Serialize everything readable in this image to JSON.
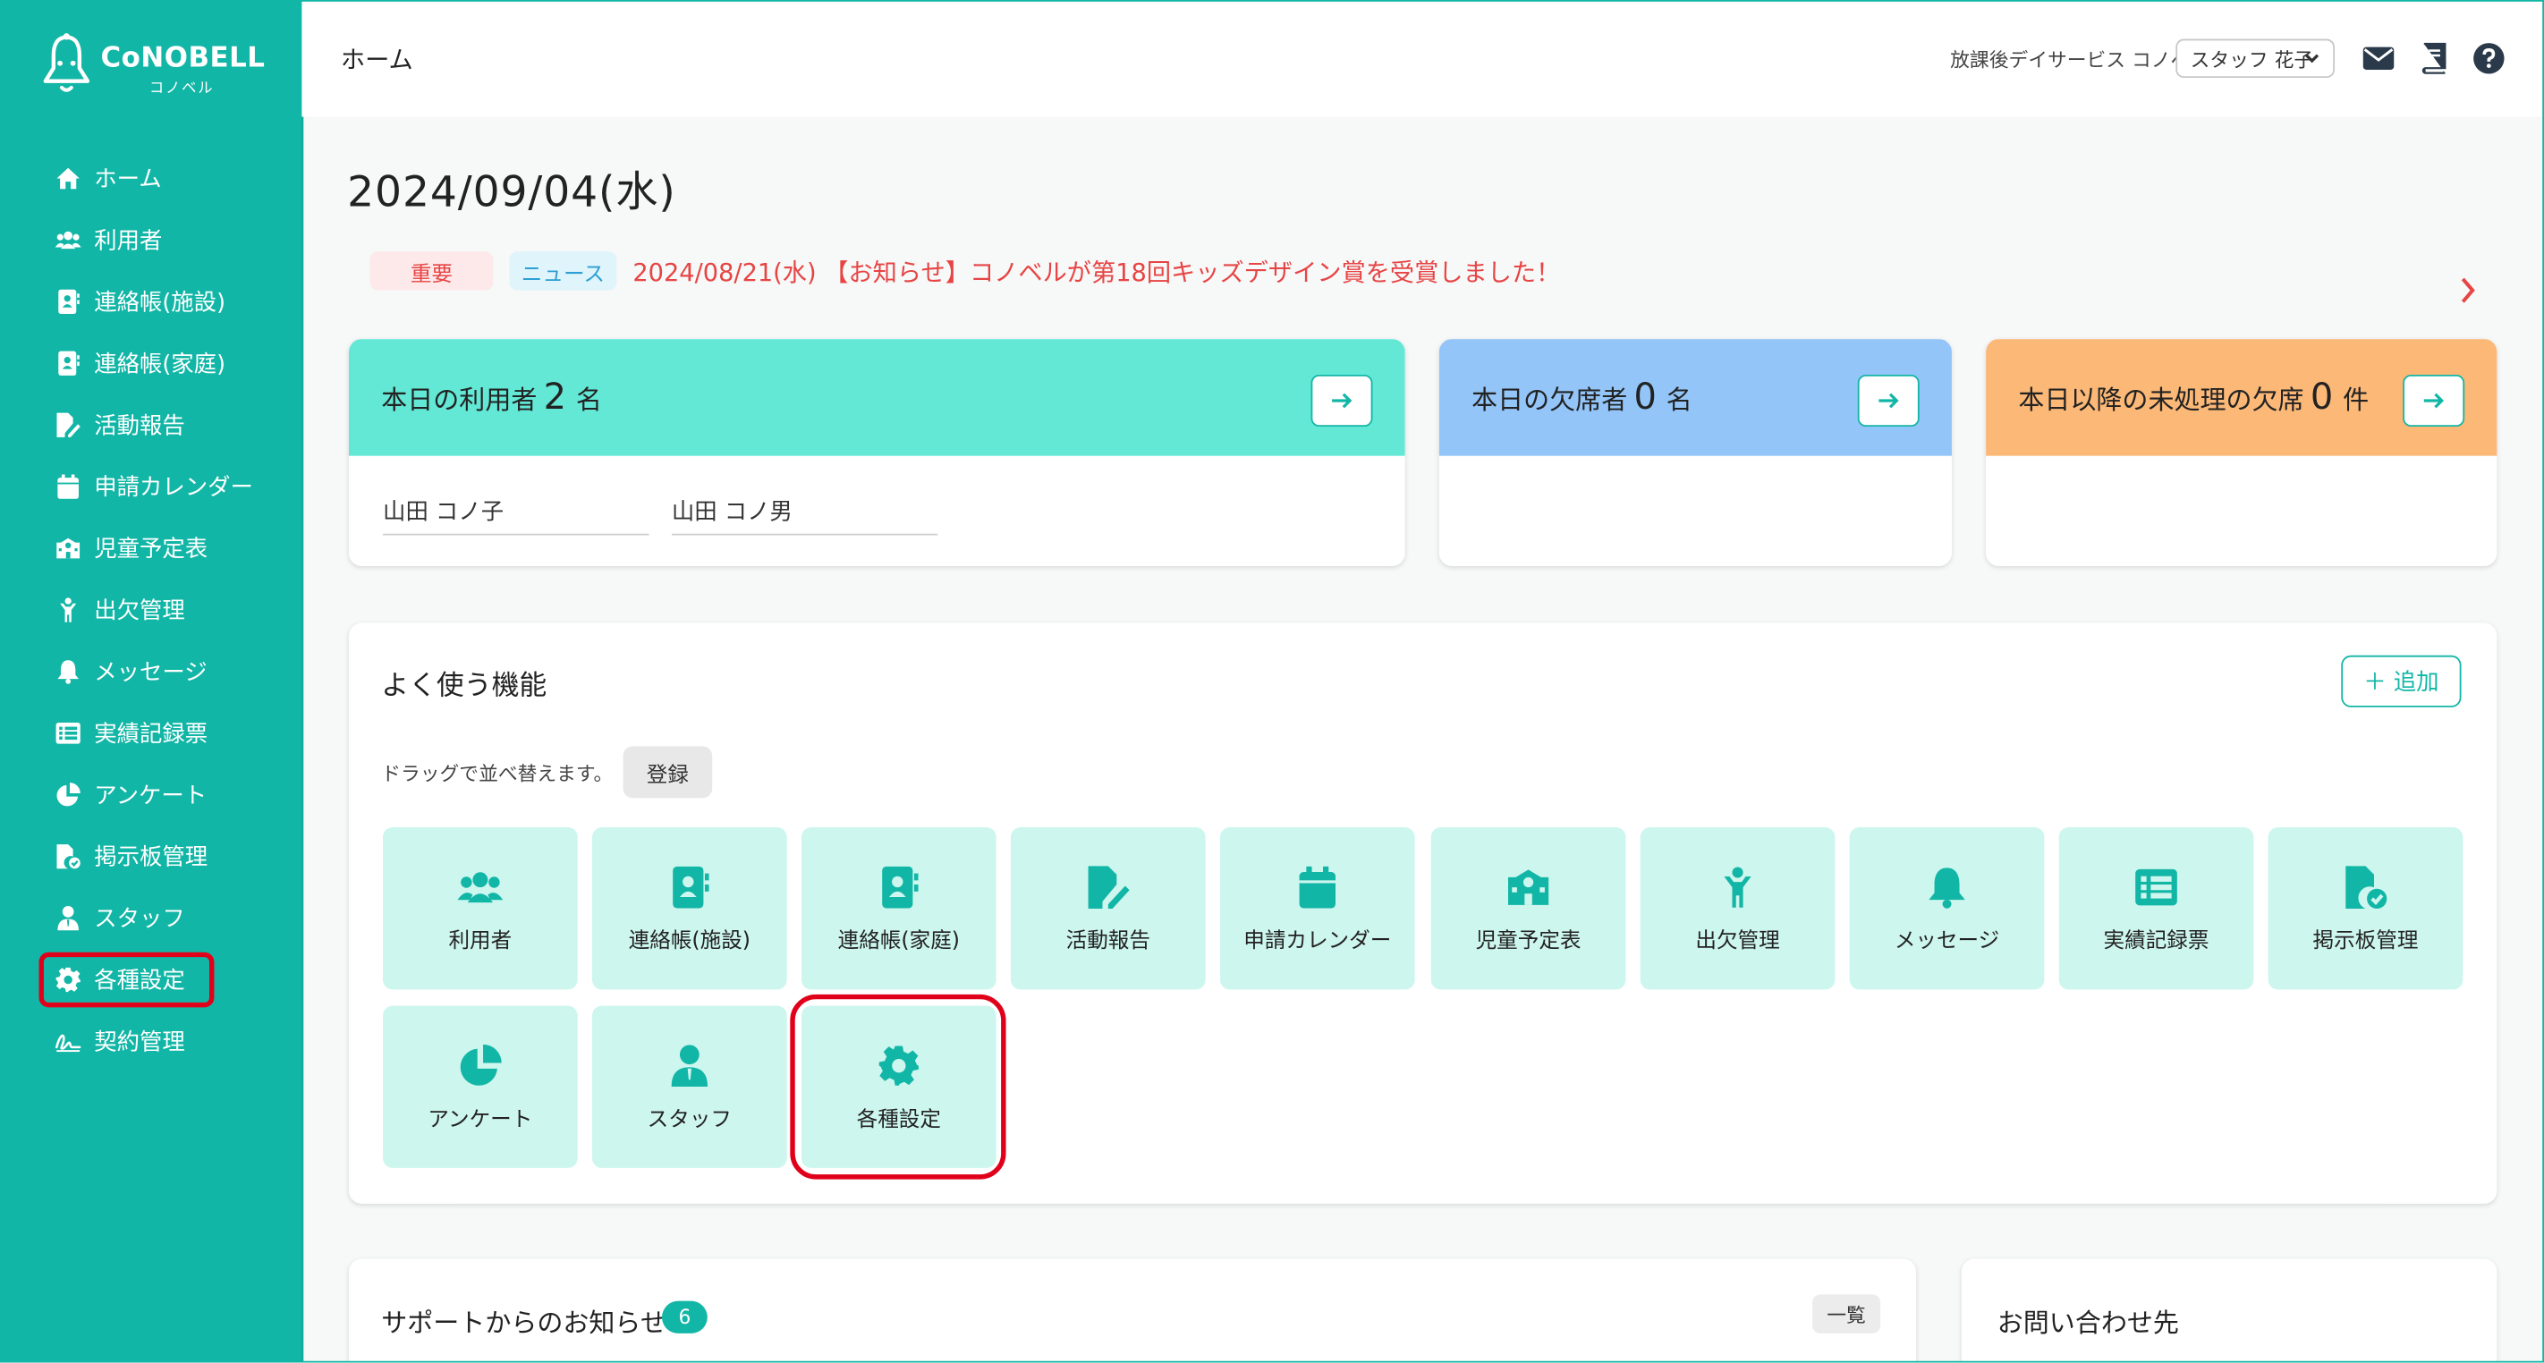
{
  "app": {
    "logo_text": "CoNOBELL",
    "logo_sub": "コノベル"
  },
  "sidebar": {
    "items": [
      {
        "label": "ホーム",
        "icon": "home-icon"
      },
      {
        "label": "利用者",
        "icon": "users-icon"
      },
      {
        "label": "連絡帳(施設)",
        "icon": "contact-book-icon"
      },
      {
        "label": "連絡帳(家庭)",
        "icon": "contact-book-icon"
      },
      {
        "label": "活動報告",
        "icon": "file-edit-icon"
      },
      {
        "label": "申請カレンダー",
        "icon": "calendar-icon"
      },
      {
        "label": "児童予定表",
        "icon": "school-icon"
      },
      {
        "label": "出欠管理",
        "icon": "child-icon"
      },
      {
        "label": "メッセージ",
        "icon": "bell-icon"
      },
      {
        "label": "実績記録票",
        "icon": "table-list-icon"
      },
      {
        "label": "アンケート",
        "icon": "pie-chart-icon"
      },
      {
        "label": "掲示板管理",
        "icon": "file-check-icon"
      },
      {
        "label": "スタッフ",
        "icon": "staff-icon"
      },
      {
        "label": "各種設定",
        "icon": "gear-icon",
        "highlighted": true
      },
      {
        "label": "契約管理",
        "icon": "signature-icon"
      }
    ]
  },
  "header": {
    "breadcrumb": "ホーム",
    "facility": "放課後デイサービス コノベル",
    "staff_selected": "スタッフ 花子"
  },
  "main": {
    "date": "2024/09/04(水)",
    "news": {
      "tag_important": "重要",
      "tag_news": "ニュース",
      "text": "2024/08/21(水) 【お知らせ】コノベルが第18回キッズデザイン賞を受賞しました！"
    },
    "cards": [
      {
        "prefix": "本日の利用者",
        "count": "2",
        "unit": "名",
        "color": "#63e8d6"
      },
      {
        "prefix": "本日の欠席者",
        "count": "0",
        "unit": "名",
        "color": "#93c5f8"
      },
      {
        "prefix": "本日以降の未処理の欠席",
        "count": "0",
        "unit": "件",
        "color": "#fbb877"
      }
    ],
    "today_users": [
      "山田 コノ子",
      "山田 コノ男"
    ],
    "favorites": {
      "title": "よく使う機能",
      "add_label": "＋ 追加",
      "drag_hint": "ドラッグで並べ替えます。",
      "register_label": "登録",
      "tiles": [
        {
          "label": "利用者",
          "icon": "users-icon"
        },
        {
          "label": "連絡帳(施設)",
          "icon": "contact-book-icon"
        },
        {
          "label": "連絡帳(家庭)",
          "icon": "contact-book-icon"
        },
        {
          "label": "活動報告",
          "icon": "file-edit-icon"
        },
        {
          "label": "申請カレンダー",
          "icon": "calendar-icon"
        },
        {
          "label": "児童予定表",
          "icon": "school-icon"
        },
        {
          "label": "出欠管理",
          "icon": "child-icon"
        },
        {
          "label": "メッセージ",
          "icon": "bell-icon"
        },
        {
          "label": "実績記録票",
          "icon": "table-list-icon"
        },
        {
          "label": "掲示板管理",
          "icon": "file-check-icon"
        },
        {
          "label": "アンケート",
          "icon": "pie-chart-icon"
        },
        {
          "label": "スタッフ",
          "icon": "staff-icon"
        },
        {
          "label": "各種設定",
          "icon": "gear-icon",
          "highlighted": true
        }
      ]
    },
    "support": {
      "title": "サポートからのお知らせ",
      "count": "6",
      "list_label": "一覧"
    },
    "contact": {
      "title": "お問い合わせ先"
    }
  },
  "colors": {
    "brand": "#12b6a6",
    "tile_bg": "#cdf6ee",
    "highlight": "#e1001a",
    "alert": "#e74444"
  }
}
